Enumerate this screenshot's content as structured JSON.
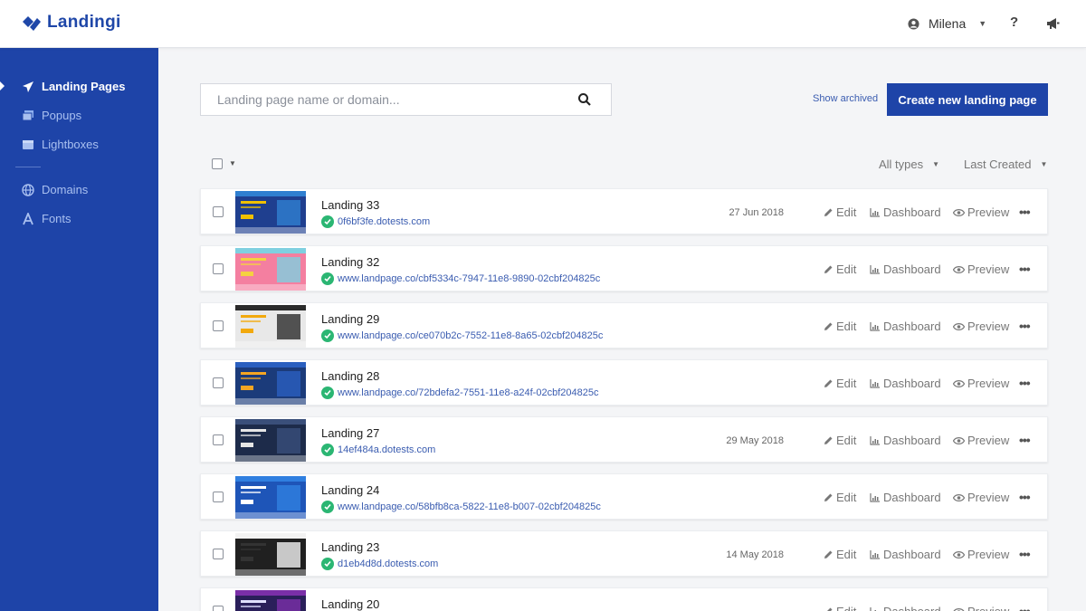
{
  "app": {
    "brand": "Landingi"
  },
  "header": {
    "user_name": "Milena",
    "help_label": "?"
  },
  "sidebar": {
    "items": [
      {
        "label": "Landing Pages",
        "icon": "paper-plane-icon",
        "active": true
      },
      {
        "label": "Popups",
        "icon": "popups-icon",
        "active": false
      },
      {
        "label": "Lightboxes",
        "icon": "lightbox-icon",
        "active": false
      },
      {
        "label": "Domains",
        "icon": "globe-icon",
        "active": false
      },
      {
        "label": "Fonts",
        "icon": "font-icon",
        "active": false
      }
    ]
  },
  "search": {
    "placeholder": "Landing page name or domain...",
    "value": ""
  },
  "toolbar": {
    "show_archived": "Show archived",
    "create_label": "Create new landing page"
  },
  "filters": {
    "type": "All types",
    "sort": "Last Created"
  },
  "actions": {
    "edit": "Edit",
    "dashboard": "Dashboard",
    "preview": "Preview",
    "more": "•••"
  },
  "colors": {
    "brand": "#1e44a8",
    "link": "#3a5cb0",
    "success": "#2bb673"
  },
  "landings": [
    {
      "name": "Landing 33",
      "url": "0f6bf3fe.dotests.com",
      "date": "27 Jun 2018"
    },
    {
      "name": "Landing 32",
      "url": "www.landpage.co/cbf5334c-7947-11e8-9890-02cbf204825c",
      "date": ""
    },
    {
      "name": "Landing 29",
      "url": "www.landpage.co/ce070b2c-7552-11e8-8a65-02cbf204825c",
      "date": ""
    },
    {
      "name": "Landing 28",
      "url": "www.landpage.co/72bdefa2-7551-11e8-a24f-02cbf204825c",
      "date": ""
    },
    {
      "name": "Landing 27",
      "url": "14ef484a.dotests.com",
      "date": "29 May 2018"
    },
    {
      "name": "Landing 24",
      "url": "www.landpage.co/58bfb8ca-5822-11e8-b007-02cbf204825c",
      "date": ""
    },
    {
      "name": "Landing 23",
      "url": "d1eb4d8d.dotests.com",
      "date": "14 May 2018"
    },
    {
      "name": "Landing 20",
      "url": "",
      "date": ""
    }
  ]
}
